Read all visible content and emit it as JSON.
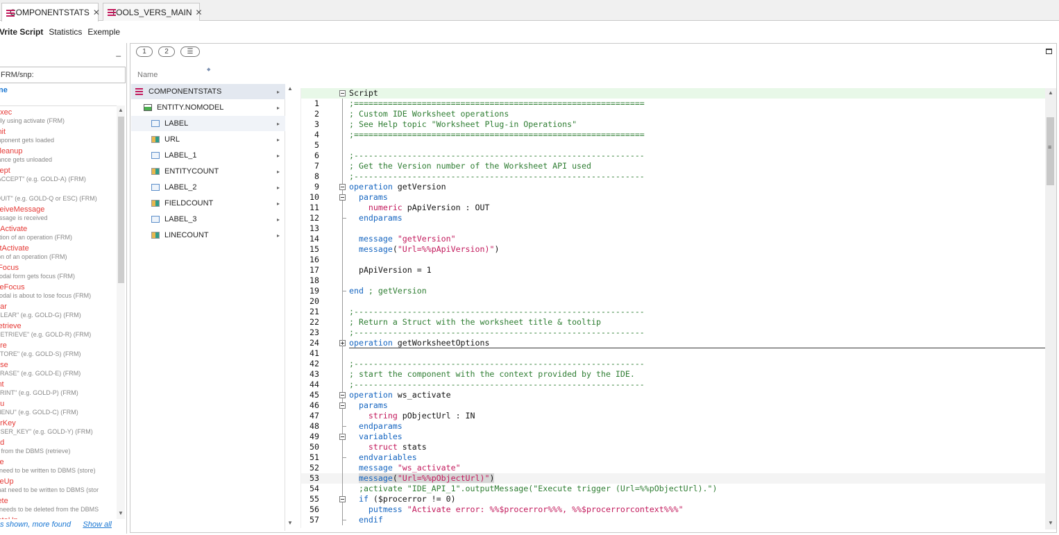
{
  "tabs": [
    {
      "label": "COMPONENTSTATS",
      "active": true
    },
    {
      "label": "TOOLS_VERS_MAIN",
      "active": false
    }
  ],
  "subtabs": [
    "Vrite Script",
    "Statistics",
    "Exemple"
  ],
  "left_panel": {
    "minimize": "_",
    "filter_value": "FRM/snp:",
    "name_header": "ne",
    "triggers": [
      {
        "name": "exec",
        "desc": "ally using activate (FRM)"
      },
      {
        "name": "init",
        "desc": "mponent gets loaded"
      },
      {
        "name": "cleanup",
        "desc": "tance gets unloaded"
      },
      {
        "name": "cept",
        "desc": "'ACCEPT\" (e.g. GOLD-A) (FRM)"
      },
      {
        "name": "it",
        "desc": "QUIT\" (e.g. GOLD-Q or ESC) (FRM)"
      },
      {
        "name": "ceiveMessage",
        "desc": "essage is received"
      },
      {
        "name": "eActivate",
        "desc": "ation of an operation (FRM)"
      },
      {
        "name": "stActivate",
        "desc": "ion of an operation (FRM)"
      },
      {
        "name": "tFocus",
        "desc": "nodal form gets focus (FRM)"
      },
      {
        "name": "seFocus",
        "desc": "nodal is about to lose focus (FRM)"
      },
      {
        "name": "ear",
        "desc": "CLEAR\" (e.g. GOLD-G) (FRM)"
      },
      {
        "name": "retrieve",
        "desc": "RETRIEVE\" (e.g. GOLD-R) (FRM)"
      },
      {
        "name": "ore",
        "desc": "STORE\" (e.g. GOLD-S) (FRM)"
      },
      {
        "name": "ase",
        "desc": "ERASE\" (e.g. GOLD-E) (FRM)"
      },
      {
        "name": "int",
        "desc": "PRINT\" (e.g. GOLD-P) (FRM)"
      },
      {
        "name": "nu",
        "desc": "MENU\" (e.g. GOLD-C) (FRM)"
      },
      {
        "name": "erKey",
        "desc": "USER_KEY\" (e.g. GOLD-Y) (FRM)"
      },
      {
        "name": "ad",
        "desc": "d from the DBMS (retrieve)"
      },
      {
        "name": "ite",
        "desc": "t need to be written to DBMS (store)"
      },
      {
        "name": "iteUp",
        "desc": "that need to be written to DBMS (stor"
      },
      {
        "name": "lete",
        "desc": "t needs to be deleted from the DBMS"
      },
      {
        "name": "leteUp",
        "desc": ""
      }
    ],
    "footer_status": "s shown, more found",
    "footer_link": "Show all"
  },
  "main_panel": {
    "toolbar": [
      "1",
      "2",
      "☰"
    ],
    "name_header": "Name",
    "tree": [
      {
        "label": "COMPONENTSTATS",
        "icon": "component-icon"
      },
      {
        "label": "ENTITY.NOMODEL",
        "icon": "entity-icon"
      },
      {
        "label": "LABEL",
        "icon": "label-icon"
      },
      {
        "label": "URL",
        "icon": "field-icon"
      },
      {
        "label": "LABEL_1",
        "icon": "label-icon"
      },
      {
        "label": "ENTITYCOUNT",
        "icon": "field-icon"
      },
      {
        "label": "LABEL_2",
        "icon": "label-icon"
      },
      {
        "label": "FIELDCOUNT",
        "icon": "field-icon"
      },
      {
        "label": "LABEL_3",
        "icon": "label-icon"
      },
      {
        "label": "LINECOUNT",
        "icon": "field-icon"
      }
    ],
    "code": [
      {
        "n": "",
        "fold": "exp",
        "segs": [
          [
            "kw",
            ""
          ],
          [
            "id",
            "Script"
          ]
        ]
      },
      {
        "n": "1",
        "segs": [
          [
            "cm",
            ";============================================================"
          ]
        ]
      },
      {
        "n": "2",
        "segs": [
          [
            "cm",
            "; Custom IDE Worksheet operations"
          ]
        ]
      },
      {
        "n": "3",
        "segs": [
          [
            "cm",
            "; See Help topic \"Worksheet Plug-in Operations\""
          ]
        ]
      },
      {
        "n": "4",
        "segs": [
          [
            "cm",
            ";============================================================"
          ]
        ]
      },
      {
        "n": "5",
        "segs": []
      },
      {
        "n": "6",
        "segs": [
          [
            "cm",
            ";------------------------------------------------------------"
          ]
        ]
      },
      {
        "n": "7",
        "segs": [
          [
            "cm",
            "; Get the Version number of the Worksheet API used"
          ]
        ]
      },
      {
        "n": "8",
        "segs": [
          [
            "cm",
            ";------------------------------------------------------------"
          ]
        ]
      },
      {
        "n": "9",
        "fold": "exp",
        "segs": [
          [
            "kw",
            "operation"
          ],
          [
            "id",
            " getVersion"
          ]
        ]
      },
      {
        "n": "10",
        "fold": "exp",
        "segs": [
          [
            "id",
            "  "
          ],
          [
            "kw",
            "params"
          ]
        ]
      },
      {
        "n": "11",
        "segs": [
          [
            "id",
            "    "
          ],
          [
            "ty",
            "numeric"
          ],
          [
            "id",
            " pApiVersion : OUT"
          ]
        ]
      },
      {
        "n": "12",
        "end": true,
        "segs": [
          [
            "id",
            "  "
          ],
          [
            "kw",
            "endparams"
          ]
        ]
      },
      {
        "n": "13",
        "segs": []
      },
      {
        "n": "14",
        "segs": [
          [
            "id",
            "  "
          ],
          [
            "kw",
            "message"
          ],
          [
            "id",
            " "
          ],
          [
            "st",
            "\"getVersion\""
          ]
        ]
      },
      {
        "n": "15",
        "segs": [
          [
            "id",
            "  "
          ],
          [
            "kw",
            "message"
          ],
          [
            "id",
            "("
          ],
          [
            "st",
            "\"Url=%%pApiVersion)\""
          ],
          [
            "id",
            ")"
          ]
        ]
      },
      {
        "n": "16",
        "segs": []
      },
      {
        "n": "17",
        "segs": [
          [
            "id",
            "  pApiVersion = 1"
          ]
        ]
      },
      {
        "n": "18",
        "segs": []
      },
      {
        "n": "19",
        "end": true,
        "segs": [
          [
            "kw",
            "end"
          ],
          [
            "cm",
            " ; getVersion"
          ]
        ]
      },
      {
        "n": "20",
        "segs": []
      },
      {
        "n": "21",
        "segs": [
          [
            "cm",
            ";------------------------------------------------------------"
          ]
        ]
      },
      {
        "n": "22",
        "segs": [
          [
            "cm",
            "; Return a Struct with the worksheet title & tooltip"
          ]
        ]
      },
      {
        "n": "23",
        "segs": [
          [
            "cm",
            ";------------------------------------------------------------"
          ]
        ]
      },
      {
        "n": "24",
        "fold": "col",
        "sep": true,
        "segs": [
          [
            "kw",
            "operation"
          ],
          [
            "id",
            " getWorksheetOptions"
          ]
        ]
      },
      {
        "n": "41",
        "segs": []
      },
      {
        "n": "42",
        "segs": [
          [
            "cm",
            ";------------------------------------------------------------"
          ]
        ]
      },
      {
        "n": "43",
        "segs": [
          [
            "cm",
            "; start the component with the context provided by the IDE."
          ]
        ]
      },
      {
        "n": "44",
        "segs": [
          [
            "cm",
            ";------------------------------------------------------------"
          ]
        ]
      },
      {
        "n": "45",
        "fold": "exp",
        "segs": [
          [
            "kw",
            "operation"
          ],
          [
            "id",
            " ws_activate"
          ]
        ]
      },
      {
        "n": "46",
        "fold": "exp",
        "segs": [
          [
            "id",
            "  "
          ],
          [
            "kw",
            "params"
          ]
        ]
      },
      {
        "n": "47",
        "segs": [
          [
            "id",
            "    "
          ],
          [
            "ty",
            "string"
          ],
          [
            "id",
            " pObjectUrl : IN"
          ]
        ]
      },
      {
        "n": "48",
        "end": true,
        "segs": [
          [
            "id",
            "  "
          ],
          [
            "kw",
            "endparams"
          ]
        ]
      },
      {
        "n": "49",
        "fold": "exp",
        "segs": [
          [
            "id",
            "  "
          ],
          [
            "kw",
            "variables"
          ]
        ]
      },
      {
        "n": "50",
        "segs": [
          [
            "id",
            "    "
          ],
          [
            "ty",
            "struct"
          ],
          [
            "id",
            " stats"
          ]
        ]
      },
      {
        "n": "51",
        "end": true,
        "segs": [
          [
            "id",
            "  "
          ],
          [
            "kw",
            "endvariables"
          ]
        ]
      },
      {
        "n": "52",
        "segs": [
          [
            "id",
            "  "
          ],
          [
            "kw",
            "message"
          ],
          [
            "id",
            " "
          ],
          [
            "st",
            "\"ws_activate\""
          ]
        ]
      },
      {
        "n": "53",
        "cur": true,
        "segs": [
          [
            "id",
            "  "
          ],
          [
            "selkw",
            "message"
          ],
          [
            "sel",
            "("
          ],
          [
            "selst",
            "\"Url=%%pObjectUrl)\""
          ],
          [
            "sel",
            ")"
          ]
        ]
      },
      {
        "n": "54",
        "segs": [
          [
            "id",
            "  "
          ],
          [
            "cm",
            ";activate \"IDE_API_1\".outputMessage(\"Execute trigger (Url=%%pObjectUrl).\")"
          ]
        ]
      },
      {
        "n": "55",
        "fold": "exp",
        "segs": [
          [
            "id",
            "  "
          ],
          [
            "kw",
            "if"
          ],
          [
            "id",
            " ($procerror != 0)"
          ]
        ]
      },
      {
        "n": "56",
        "segs": [
          [
            "id",
            "    "
          ],
          [
            "kw",
            "putmess"
          ],
          [
            "id",
            " "
          ],
          [
            "st",
            "\"Activate error: %%$procerror%%%, %%$procerrorcontext%%%\""
          ]
        ]
      },
      {
        "n": "57",
        "end": true,
        "segs": [
          [
            "id",
            "  "
          ],
          [
            "kw",
            "endif"
          ]
        ]
      }
    ]
  }
}
